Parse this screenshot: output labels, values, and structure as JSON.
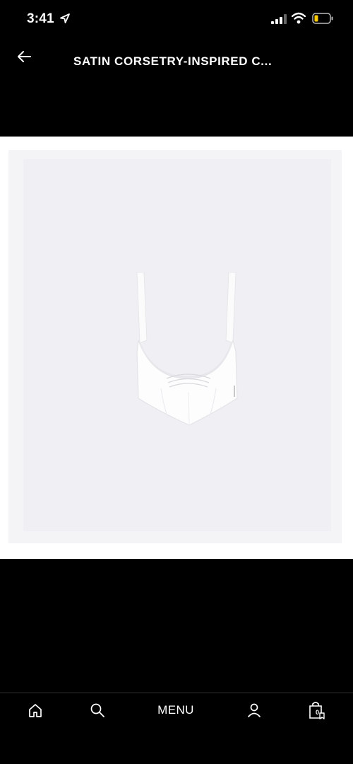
{
  "status_bar": {
    "time": "3:41",
    "icons": [
      "location-arrow-icon",
      "cellular-signal-icon",
      "wifi-icon",
      "battery-low-icon"
    ],
    "battery_color": "#ffcc00"
  },
  "header": {
    "back_icon": "back-arrow-icon",
    "title": "SATIN CORSETRY-INSPIRED C..."
  },
  "product": {
    "image": "white-satin-corset-top-image",
    "background_color": "#f0f0f4"
  },
  "tab_bar": {
    "home_icon": "home-icon",
    "search_icon": "search-icon",
    "menu_label": "MENU",
    "profile_icon": "profile-icon",
    "bag_icon": "shopping-bag-icon",
    "bag_count": "0"
  }
}
